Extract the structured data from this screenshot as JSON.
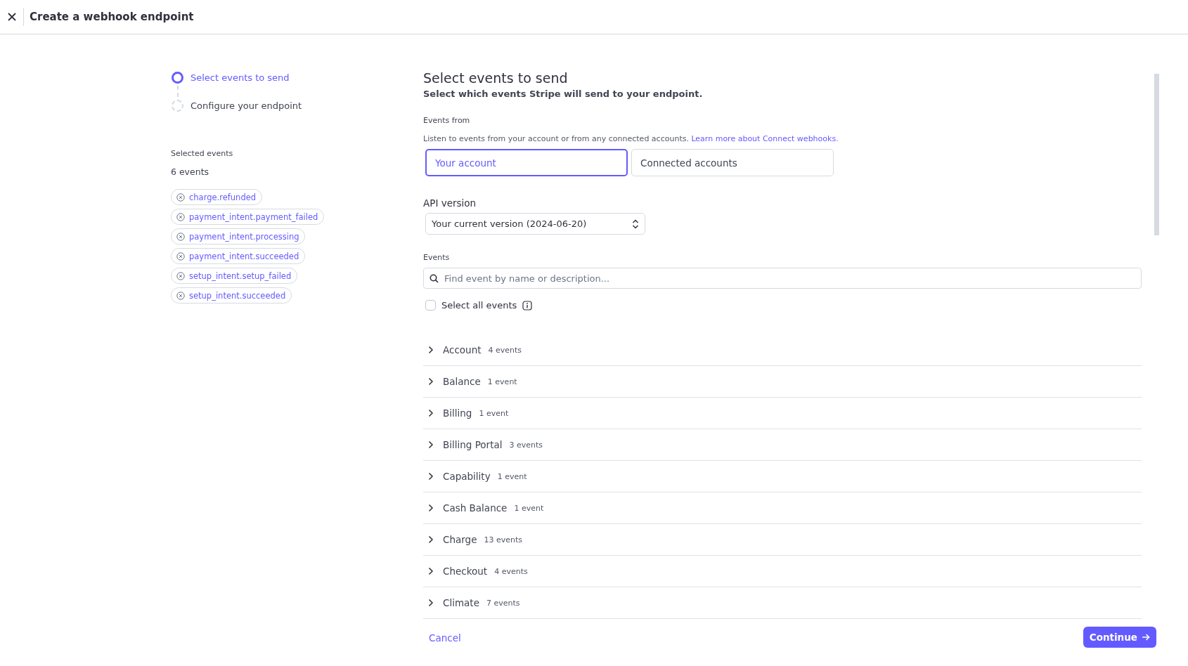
{
  "header": {
    "title": "Create a webhook endpoint"
  },
  "steps": [
    {
      "label": "Select events to send",
      "selected": true
    },
    {
      "label": "Configure your endpoint",
      "selected": false
    }
  ],
  "selected_events": {
    "label": "Selected events",
    "count": "6 events",
    "items": [
      "charge.refunded",
      "payment_intent.payment_failed",
      "payment_intent.processing",
      "payment_intent.succeeded",
      "setup_intent.setup_failed",
      "setup_intent.succeeded"
    ]
  },
  "heading": "Select events to send",
  "subtitle": "Select which events Stripe will send to your endpoint.",
  "events_from": {
    "label": "Events from",
    "help": "Listen to events from your account or from any connected accounts.",
    "link": "Learn more about Connect webhooks.",
    "options": [
      {
        "label": "Your account",
        "selected": true
      },
      {
        "label": "Connected accounts",
        "selected": false
      }
    ]
  },
  "api_version": {
    "label": "API version",
    "value": "Your current version (2024-06-20)"
  },
  "events": {
    "label": "Events",
    "placeholder": "Find event by name or description...",
    "select_all": {
      "label": "Select all events",
      "checked": false
    },
    "groups": [
      {
        "name": "Account",
        "count": "4 events",
        "expanded": false
      },
      {
        "name": "Balance",
        "count": "1 event",
        "expanded": false
      },
      {
        "name": "Billing",
        "count": "1 event",
        "expanded": false
      },
      {
        "name": "Billing Portal",
        "count": "3 events",
        "expanded": false
      },
      {
        "name": "Capability",
        "count": "1 event",
        "expanded": false
      },
      {
        "name": "Cash Balance",
        "count": "1 event",
        "expanded": false
      },
      {
        "name": "Charge",
        "count": "13 events",
        "expanded": false
      },
      {
        "name": "Checkout",
        "count": "4 events",
        "expanded": false
      },
      {
        "name": "Climate",
        "count": "7 events",
        "expanded": false
      }
    ]
  },
  "footer": {
    "cancel": "Cancel",
    "continue": "Continue"
  }
}
